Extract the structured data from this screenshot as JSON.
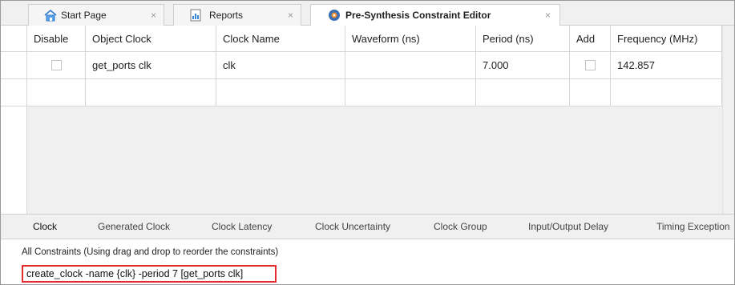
{
  "tabs": [
    {
      "label": "Start Page",
      "icon": "home-icon",
      "close": "×"
    },
    {
      "label": "Reports",
      "icon": "report-icon",
      "close": "×"
    },
    {
      "label": "Pre-Synthesis Constraint Editor",
      "icon": "constraint-editor-icon",
      "close": "×"
    }
  ],
  "grid": {
    "columns": [
      "Disable",
      "Object Clock",
      "Clock Name",
      "Waveform (ns)",
      "Period (ns)",
      "Add",
      "Frequency (MHz)"
    ],
    "rows": [
      {
        "disable": false,
        "object_clock": "get_ports clk",
        "clock_name": "clk",
        "waveform": "",
        "period": "7.000",
        "add": false,
        "frequency": "142.857"
      },
      {
        "disable": null,
        "object_clock": "",
        "clock_name": "",
        "waveform": "",
        "period": "",
        "add": null,
        "frequency": ""
      }
    ]
  },
  "bottom_tabs": [
    "Clock",
    "Generated Clock",
    "Clock Latency",
    "Clock Uncertainty",
    "Clock Group",
    "Input/Output Delay",
    "Timing Exception"
  ],
  "active_bottom_tab": "Clock",
  "constraints": {
    "title": "All Constraints (Using drag and drop to reorder the constraints)",
    "command": "create_clock -name {clk} -period 7 [get_ports clk]"
  },
  "colors": {
    "highlight_border": "#e32b2b",
    "tab_bar": "#f0f0f0"
  }
}
